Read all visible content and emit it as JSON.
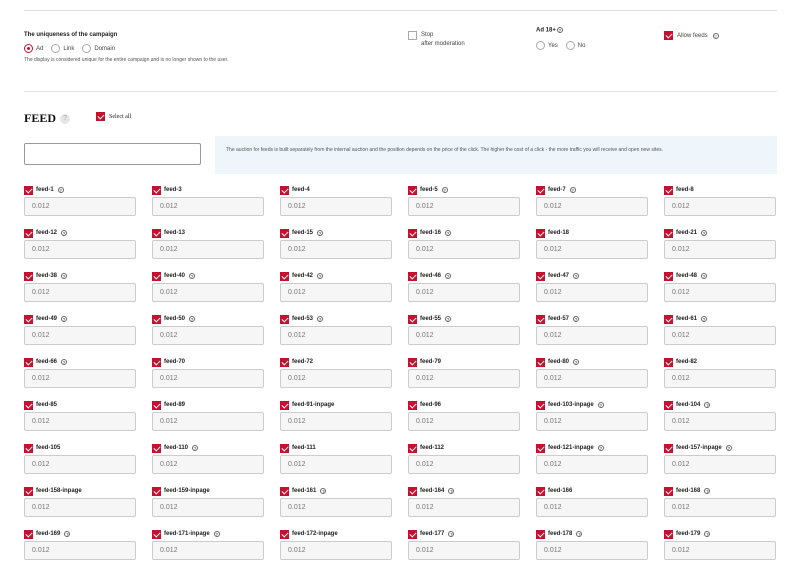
{
  "campaign": {
    "uniqueness_title": "The uniqueness of the campaign",
    "uniqueness_options": [
      {
        "label": "Ad",
        "selected": true
      },
      {
        "label": "Link",
        "selected": false
      },
      {
        "label": "Domain",
        "selected": false
      }
    ],
    "uniqueness_note": "The display is considered unique for the entire campaign and is no longer shown to the user.",
    "stop_label_1": "Stop",
    "stop_label_2": "after moderation",
    "stop_checked": false,
    "ad18_title": "Ad 18+",
    "ad18_options": [
      {
        "label": "Yes",
        "selected": false
      },
      {
        "label": "No",
        "selected": false
      }
    ],
    "allow_feeds_label": "Allow feeds",
    "allow_feeds_checked": true
  },
  "feed": {
    "title": "FEED",
    "select_all_label": "Select all",
    "select_all_checked": true,
    "search_value": "",
    "info_text": "The auction for feeds is built separately from the internal auction and the position depends on the price of the click. The higher the cost of a click - the more traffic you will receive and open new sites.",
    "items": [
      {
        "name": "feed-1",
        "help": true,
        "value": "0.012"
      },
      {
        "name": "feed-3",
        "help": false,
        "value": "0.012"
      },
      {
        "name": "feed-4",
        "help": false,
        "value": "0.012"
      },
      {
        "name": "feed-5",
        "help": true,
        "value": "0.012"
      },
      {
        "name": "feed-7",
        "help": true,
        "value": "0.012"
      },
      {
        "name": "feed-8",
        "help": false,
        "value": "0.012"
      },
      {
        "name": "feed-12",
        "help": true,
        "value": "0.012"
      },
      {
        "name": "feed-13",
        "help": false,
        "value": "0.012"
      },
      {
        "name": "feed-15",
        "help": true,
        "value": "0.012"
      },
      {
        "name": "feed-16",
        "help": true,
        "value": "0.012"
      },
      {
        "name": "feed-18",
        "help": false,
        "value": "0.012"
      },
      {
        "name": "feed-21",
        "help": true,
        "value": "0.012"
      },
      {
        "name": "feed-38",
        "help": true,
        "value": "0.012"
      },
      {
        "name": "feed-40",
        "help": true,
        "value": "0.012"
      },
      {
        "name": "feed-42",
        "help": true,
        "value": "0.012"
      },
      {
        "name": "feed-46",
        "help": true,
        "value": "0.012"
      },
      {
        "name": "feed-47",
        "help": true,
        "value": "0.012"
      },
      {
        "name": "feed-48",
        "help": true,
        "value": "0.012"
      },
      {
        "name": "feed-49",
        "help": true,
        "value": "0.012"
      },
      {
        "name": "feed-50",
        "help": true,
        "value": "0.012"
      },
      {
        "name": "feed-53",
        "help": true,
        "value": "0.012"
      },
      {
        "name": "feed-55",
        "help": true,
        "value": "0.012"
      },
      {
        "name": "feed-57",
        "help": true,
        "value": "0.012"
      },
      {
        "name": "feed-61",
        "help": true,
        "value": "0.012"
      },
      {
        "name": "feed-66",
        "help": true,
        "value": "0.012"
      },
      {
        "name": "feed-70",
        "help": false,
        "value": "0.012"
      },
      {
        "name": "feed-72",
        "help": false,
        "value": "0.012"
      },
      {
        "name": "feed-79",
        "help": false,
        "value": "0.012"
      },
      {
        "name": "feed-80",
        "help": true,
        "value": "0.012"
      },
      {
        "name": "feed-82",
        "help": false,
        "value": "0.012"
      },
      {
        "name": "feed-85",
        "help": false,
        "value": "0.012"
      },
      {
        "name": "feed-89",
        "help": false,
        "value": "0.012"
      },
      {
        "name": "feed-91-inpage",
        "help": false,
        "value": "0.012"
      },
      {
        "name": "feed-96",
        "help": false,
        "value": "0.012"
      },
      {
        "name": "feed-103-inpage",
        "help": true,
        "value": "0.012"
      },
      {
        "name": "feed-104",
        "help": true,
        "value": "0.012"
      },
      {
        "name": "feed-105",
        "help": false,
        "value": "0.012"
      },
      {
        "name": "feed-110",
        "help": true,
        "value": "0.012"
      },
      {
        "name": "feed-111",
        "help": false,
        "value": "0.012"
      },
      {
        "name": "feed-112",
        "help": false,
        "value": "0.012"
      },
      {
        "name": "feed-121-inpage",
        "help": true,
        "value": "0.012"
      },
      {
        "name": "feed-157-inpage",
        "help": true,
        "value": "0.012"
      },
      {
        "name": "feed-158-inpage",
        "help": false,
        "value": "0.012"
      },
      {
        "name": "feed-159-inpage",
        "help": false,
        "value": "0.012"
      },
      {
        "name": "feed-161",
        "help": true,
        "value": "0.012"
      },
      {
        "name": "feed-164",
        "help": true,
        "value": "0.012"
      },
      {
        "name": "feed-166",
        "help": false,
        "value": "0.012"
      },
      {
        "name": "feed-168",
        "help": true,
        "value": "0.012"
      },
      {
        "name": "feed-169",
        "help": true,
        "value": "0.012"
      },
      {
        "name": "feed-171-inpage",
        "help": true,
        "value": "0.012"
      },
      {
        "name": "feed-172-inpage",
        "help": false,
        "value": "0.012"
      },
      {
        "name": "feed-177",
        "help": true,
        "value": "0.012"
      },
      {
        "name": "feed-178",
        "help": true,
        "value": "0.012"
      },
      {
        "name": "feed-179",
        "help": true,
        "value": "0.012"
      }
    ]
  },
  "colors": {
    "accent": "#c8102e",
    "info_bg": "#eef6fc"
  }
}
